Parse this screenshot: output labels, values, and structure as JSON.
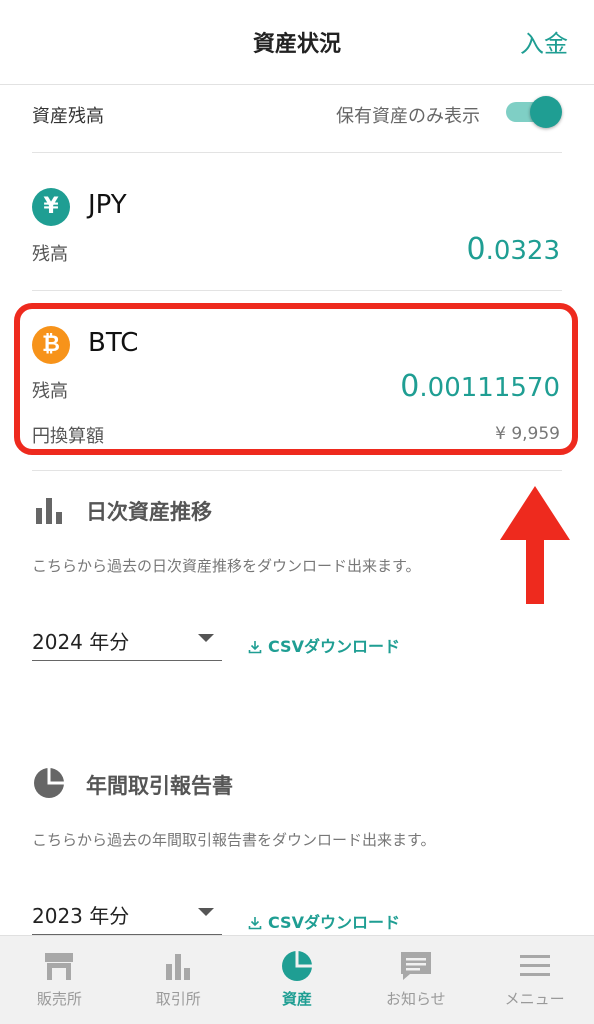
{
  "header": {
    "title": "資産状況",
    "deposit_label": "入金"
  },
  "balance_row": {
    "label": "資産残高",
    "toggle_label": "保有資産のみ表示",
    "toggle_on": true
  },
  "assets": [
    {
      "symbol": "¥",
      "name": "JPY",
      "balance_label": "残高",
      "balance_lead": "0",
      "balance_rest": ".0323",
      "color": "#1f9e93"
    },
    {
      "symbol": "₿",
      "name": "BTC",
      "balance_label": "残高",
      "balance_lead": "0",
      "balance_rest": ".00111570",
      "jpy_label": "円換算額",
      "jpy_value": "¥ 9,959",
      "color": "#f7931a"
    }
  ],
  "daily": {
    "title": "日次資産推移",
    "description": "こちらから過去の日次資産推移をダウンロード出来ます。",
    "year": "2024 年分",
    "csv_label": "CSVダウンロード"
  },
  "annual": {
    "title": "年間取引報告書",
    "description": "こちらから過去の年間取引報告書をダウンロード出来ます。",
    "year": "2023 年分",
    "csv_label": "CSVダウンロード"
  },
  "nav": [
    {
      "label": "販売所",
      "icon": "store-icon",
      "active": false
    },
    {
      "label": "取引所",
      "icon": "bar-chart-icon",
      "active": false
    },
    {
      "label": "資産",
      "icon": "pie-chart-icon",
      "active": true
    },
    {
      "label": "お知らせ",
      "icon": "message-icon",
      "active": false
    },
    {
      "label": "メニュー",
      "icon": "menu-icon",
      "active": false
    }
  ],
  "colors": {
    "accent": "#1f9e93",
    "highlight": "#ee2a1e",
    "btc": "#f7931a"
  }
}
